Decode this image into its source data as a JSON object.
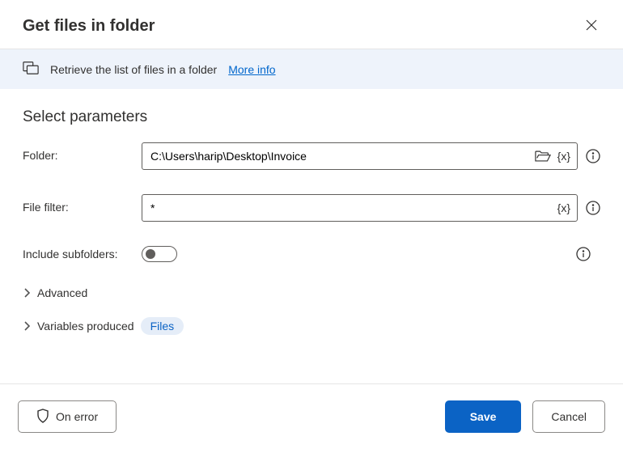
{
  "header": {
    "title": "Get files in folder"
  },
  "banner": {
    "text": "Retrieve the list of files in a folder",
    "more_info": "More info"
  },
  "section_title": "Select parameters",
  "fields": {
    "folder": {
      "label": "Folder:",
      "value": "C:\\Users\\harip\\Desktop\\Invoice"
    },
    "file_filter": {
      "label": "File filter:",
      "value": "*"
    },
    "include_subfolders": {
      "label": "Include subfolders:",
      "value": false
    }
  },
  "collapsibles": {
    "advanced": "Advanced",
    "variables_produced": "Variables produced",
    "variables_pill": "Files"
  },
  "footer": {
    "on_error": "On error",
    "save": "Save",
    "cancel": "Cancel"
  }
}
